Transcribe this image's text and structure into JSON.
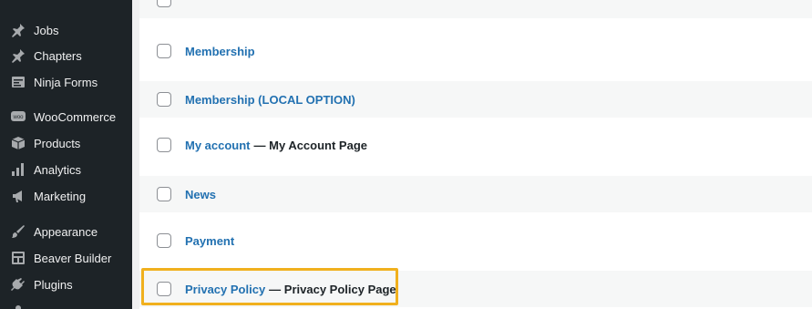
{
  "sidebar": {
    "items": [
      {
        "label": "Jobs",
        "icon": "pin-icon"
      },
      {
        "label": "Chapters",
        "icon": "pin-icon"
      },
      {
        "label": "Ninja Forms",
        "icon": "forms-icon"
      },
      {
        "label": "WooCommerce",
        "icon": "woo-icon"
      },
      {
        "label": "Products",
        "icon": "products-icon"
      },
      {
        "label": "Analytics",
        "icon": "bar-chart-icon"
      },
      {
        "label": "Marketing",
        "icon": "megaphone-icon"
      },
      {
        "label": "Appearance",
        "icon": "paintbrush-icon"
      },
      {
        "label": "Beaver Builder",
        "icon": "layout-icon"
      },
      {
        "label": "Plugins",
        "icon": "plugin-icon"
      }
    ]
  },
  "pages": [
    {
      "title": "Membership",
      "state": ""
    },
    {
      "title": "Membership (LOCAL OPTION)",
      "state": ""
    },
    {
      "title": "My account",
      "state": "— My Account Page"
    },
    {
      "title": "News",
      "state": ""
    },
    {
      "title": "Payment",
      "state": ""
    },
    {
      "title": "Privacy Policy",
      "state": "— Privacy Policy Page"
    }
  ],
  "colors": {
    "sidebar_bg": "#1d2327",
    "link": "#2271b1",
    "highlight": "#f0b01e"
  }
}
